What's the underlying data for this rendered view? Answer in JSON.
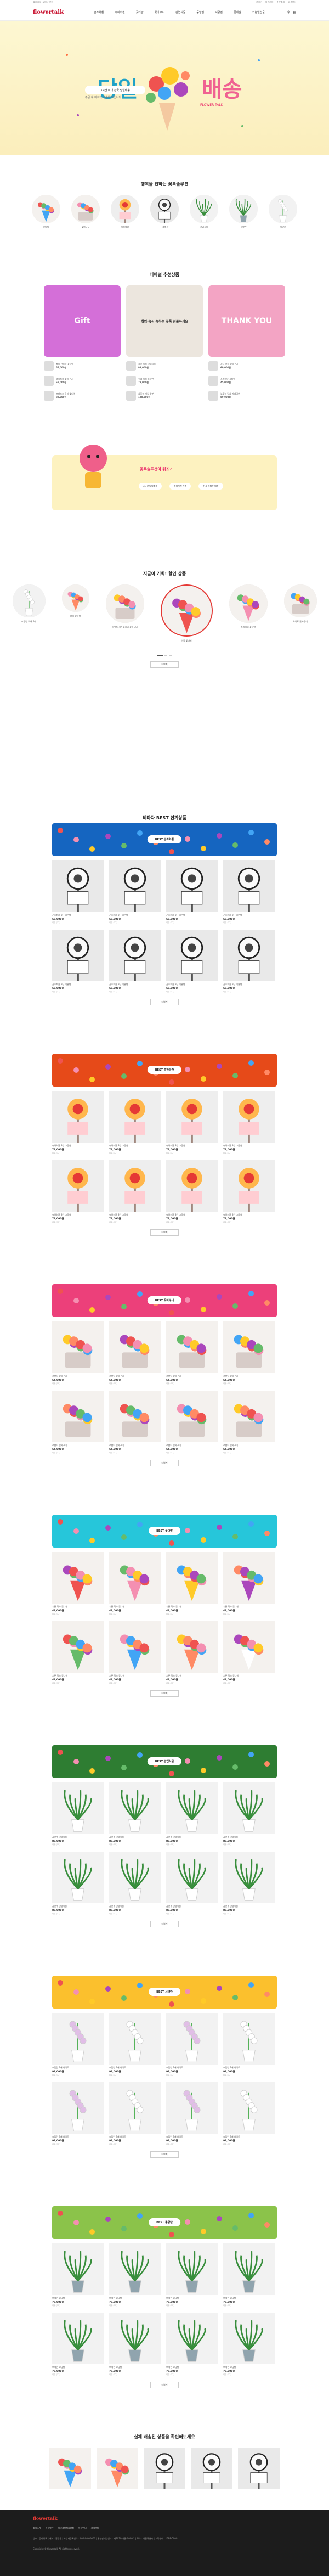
{
  "header": {
    "logo": "flowertalk",
    "gnb": [
      "근조화환",
      "축하화환",
      "꽃다발",
      "꽃바구니",
      "관엽식물",
      "동양란",
      "서양란",
      "꽃배달",
      "기념일선물"
    ],
    "topbar_left": [
      "플라워톡",
      "꽃배달 전문"
    ],
    "topbar_right": [
      "로그인",
      "회원가입",
      "주문조회",
      "고객센터"
    ]
  },
  "hero": {
    "title_left": "당일",
    "title_right": "배송",
    "subtitle": "3시간 이내 전국 당일배송",
    "subtitle2": "주문 후 빠르게 배송해 드립니다",
    "find_link": "FLOWER TALK"
  },
  "categories": {
    "title": "행복을 전하는 꽃톡솔루션",
    "items": [
      "꽃다발",
      "꽃바구니",
      "축하화환",
      "근조화환",
      "관엽식물",
      "동양란",
      "서양란"
    ]
  },
  "recommend": {
    "title": "테마별 추천상품",
    "cards": [
      {
        "label": "Gift",
        "bg": "#d46fd8",
        "items": [
          [
            "축하 선물용 꽃다발",
            "55,000원"
          ],
          [
            "생일축하 꽃바구니",
            "65,000원"
          ],
          [
            "프러포즈 장미 꽃다발",
            "89,000원"
          ]
        ]
      },
      {
        "label": "취업·승진 축하는 꽃톡 선물하세요",
        "bg": "#ece6de",
        "items": [
          [
            "승진 축하 관엽식물",
            "99,000원"
          ],
          [
            "취업 축하 동양란",
            "79,000원"
          ],
          [
            "사무실 개업 화분",
            "120,000원"
          ]
        ]
      },
      {
        "label": "THANK YOU",
        "bg": "#f3a4c4",
        "items": [
          [
            "감사 선물 꽃바구니",
            "69,000원"
          ],
          [
            "스승의날 꽃다발",
            "45,000원"
          ],
          [
            "부모님 감사 카네이션",
            "59,000원"
          ]
        ]
      }
    ]
  },
  "banner": {
    "title": "꽃톡솔루션이 뭐죠?",
    "chips": [
      "3시간 당일배송",
      "실물사진 전송",
      "전국 어디든 배송"
    ]
  },
  "deal": {
    "title": "지금이 기회! 할인 상품",
    "items": [
      "호접란 백색 5대",
      "장미 꽃다발",
      "스위트 시즌플라워 꽃바구니",
      "수국 꽃다발",
      "프리미엄 꽃다발",
      "화이트 꽃바구니"
    ],
    "more": "더보기"
  },
  "best": {
    "title": "테마다 BEST 인기상품",
    "sections": [
      {
        "label": "BEST 근조화환",
        "bg": "#1565c0",
        "kind": "wreath",
        "name": "근조화환 3단 기본형",
        "price": "69,000원"
      },
      {
        "label": "BEST 축하화환",
        "bg": "#e64a19",
        "kind": "celebrate",
        "name": "축하화환 3단 고급형",
        "price": "79,000원"
      },
      {
        "label": "BEST 꽃바구니",
        "bg": "#ec407a",
        "kind": "basket",
        "name": "로맨틱 꽃바구니",
        "price": "65,000원"
      },
      {
        "label": "BEST 꽃다발",
        "bg": "#26c6da",
        "kind": "bouquet",
        "name": "시즌 믹스 꽃다발",
        "price": "49,000원"
      },
      {
        "label": "BEST 관엽식물",
        "bg": "#2e7d32",
        "kind": "plant",
        "name": "금전수 관엽식물",
        "price": "89,000원"
      },
      {
        "label": "BEST 서양란",
        "bg": "#fbc02d",
        "kind": "orchid",
        "name": "호접란 3대 화이트",
        "price": "99,000원"
      },
      {
        "label": "BEST 동양란",
        "bg": "#8bc34a",
        "kind": "easternorchid",
        "name": "보세란 고급형",
        "price": "79,000원"
      }
    ],
    "review_text": "리뷰 (12)",
    "more": "더보기"
  },
  "real": {
    "title": "실제 배송된 상품을 확인해보세요"
  },
  "footer": {
    "logo": "flowertalk",
    "menu": [
      "회사소개",
      "이용약관",
      "개인정보처리방침",
      "이용안내",
      "고객센터"
    ],
    "info": "상호 : 플라워톡 | 대표 : 홍길동 | 사업자등록번호 : 000-00-00000 | 통신판매업신고 : 제2020-서울-0000호 | 주소 : 서울특별시 | 고객센터 : 1588-0000",
    "copy": "Copyright © flowertalk All rights reserved."
  }
}
